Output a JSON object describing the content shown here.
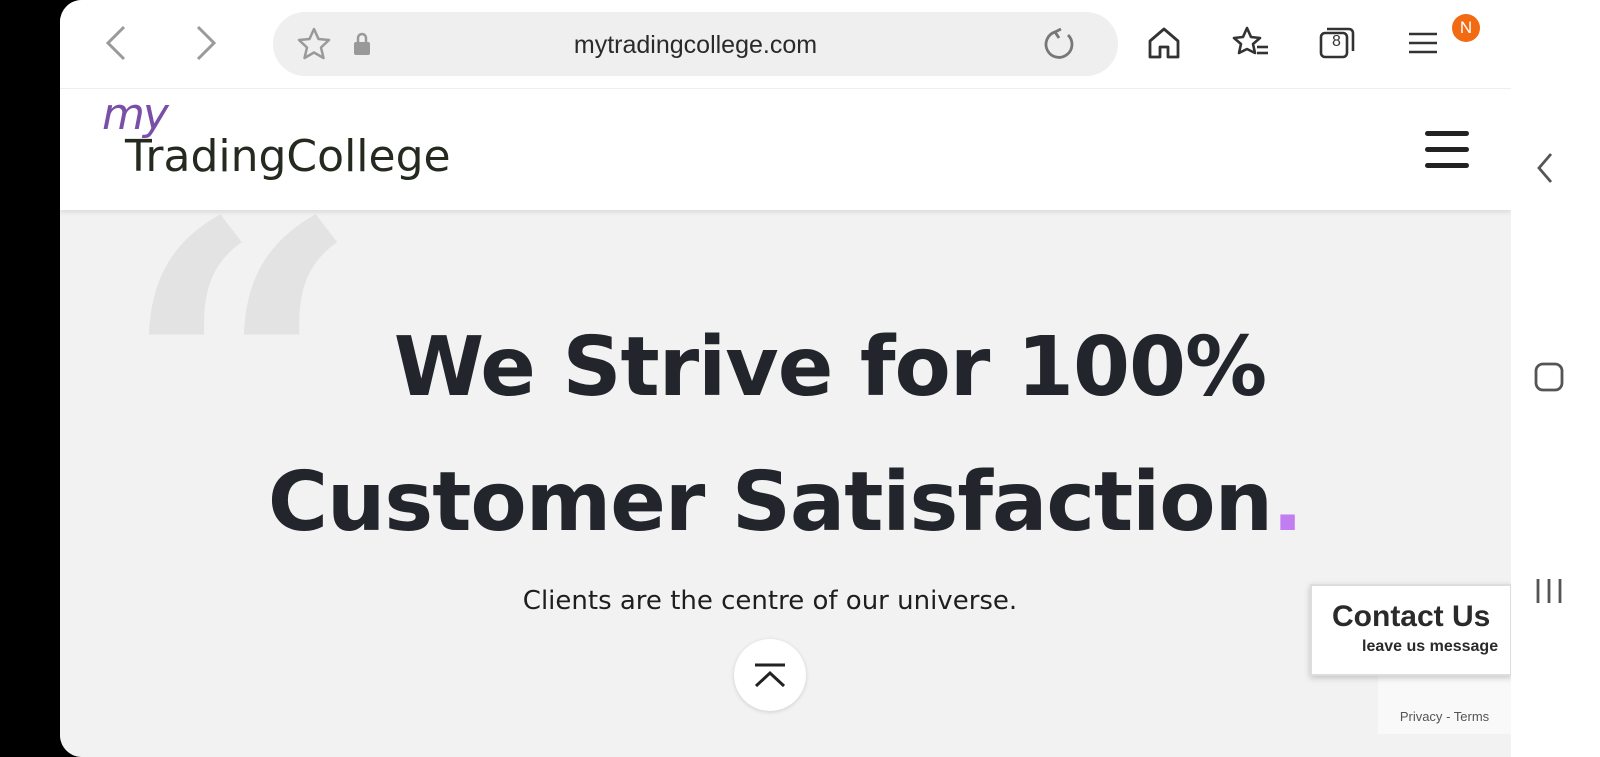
{
  "browser": {
    "url": "mytradingcollege.com",
    "tabs_count": "8",
    "notification_badge": "N"
  },
  "site": {
    "logo_my": "my",
    "logo_main": "TradingCollege"
  },
  "hero": {
    "headline_line1": "We Strive for 100%",
    "headline_line2": "Customer Satisfaction",
    "headline_dot": ".",
    "subline": "Clients are the centre of our universe."
  },
  "contact_widget": {
    "title": "Contact Us",
    "subtitle": "leave us message"
  },
  "recaptcha": {
    "privacy": "Privacy",
    "separator": "-",
    "terms": "Terms"
  },
  "colors": {
    "accent_dot": "#c17ef0",
    "logo_purple": "#7a4fa8",
    "badge_orange": "#f26a12"
  }
}
